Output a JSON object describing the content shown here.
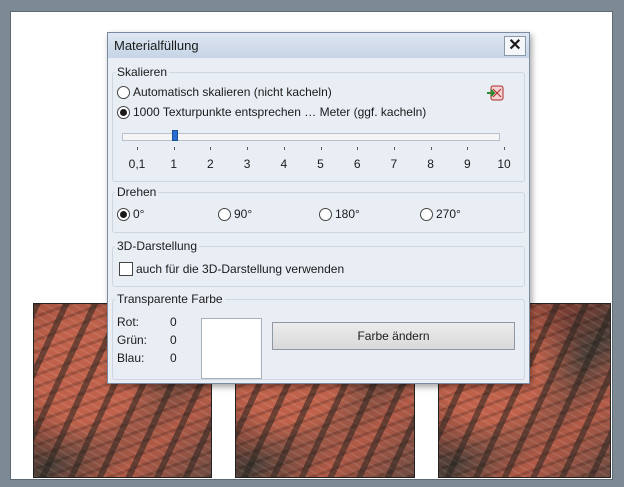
{
  "dialog": {
    "title": "Materialfüllung",
    "close_label": "✕"
  },
  "scale": {
    "legend": "Skalieren",
    "auto_label": "Automatisch skalieren (nicht kacheln)",
    "texel_label": "1000 Texturpunkte entsprechen … Meter (ggf. kacheln)",
    "selected": "texel",
    "slider_value": 1,
    "ticks": [
      "0,1",
      "1",
      "2",
      "3",
      "4",
      "5",
      "6",
      "7",
      "8",
      "9",
      "10"
    ],
    "pick_icon": "texture-pick-icon"
  },
  "rotate": {
    "legend": "Drehen",
    "options": [
      "0°",
      "90°",
      "180°",
      "270°"
    ],
    "selected": "0°"
  },
  "display3d": {
    "legend": "3D-Darstellung",
    "checkbox_label": "auch für die 3D-Darstellung verwenden",
    "checked": false
  },
  "transparent": {
    "legend": "Transparente Farbe",
    "red_label": "Rot:",
    "green_label": "Grün:",
    "blue_label": "Blau:",
    "red": "0",
    "green": "0",
    "blue": "0",
    "swatch_color": "#ffffff",
    "change_button": "Farbe ändern"
  },
  "colors": {
    "desktop": "#7d8a93",
    "dialog_bg": "#e9eef5",
    "slider_thumb": "#2a6fd0"
  }
}
